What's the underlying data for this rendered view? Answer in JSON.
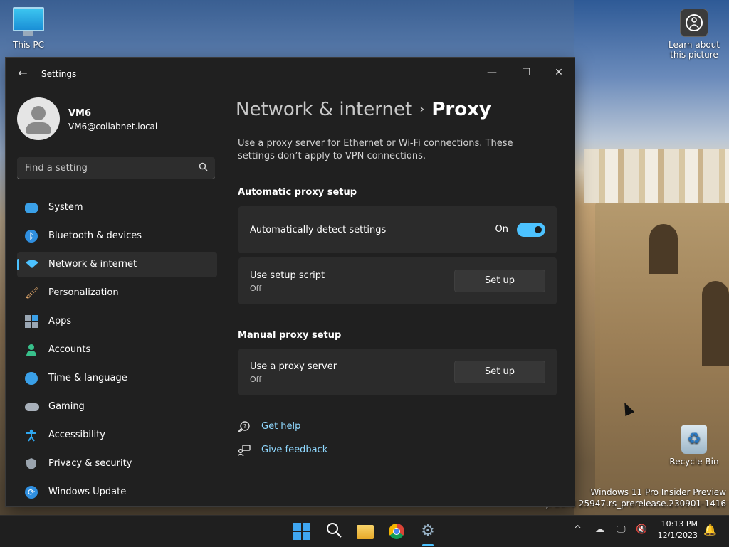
{
  "desktop": {
    "this_pc": "This PC",
    "learn_about_line1": "Learn about",
    "learn_about_line2": "this picture",
    "recycle_bin": "Recycle Bin",
    "watermark_line1": "Windows 11 Pro Insider Preview",
    "watermark_line2": "y. Build 25947.rs_prerelease.230901-1416"
  },
  "window": {
    "title": "Settings",
    "minimize": "—",
    "maximize": "☐",
    "close": "✕"
  },
  "profile": {
    "name": "VM6",
    "email": "VM6@collabnet.local"
  },
  "search": {
    "placeholder": "Find a setting"
  },
  "nav": {
    "items": [
      {
        "label": "System",
        "icon": "monitor-icon",
        "color": "#3aa0e8"
      },
      {
        "label": "Bluetooth & devices",
        "icon": "bluetooth-icon",
        "color": "#2f8fe0"
      },
      {
        "label": "Network & internet",
        "icon": "wifi-icon",
        "color": "#4cc2ff",
        "selected": true
      },
      {
        "label": "Personalization",
        "icon": "brush-icon",
        "color": "#e2a86b"
      },
      {
        "label": "Apps",
        "icon": "apps-icon",
        "color": "#9aa7b4"
      },
      {
        "label": "Accounts",
        "icon": "person-icon",
        "color": "#38c08b"
      },
      {
        "label": "Time & language",
        "icon": "globe-clock-icon",
        "color": "#3aa0e8"
      },
      {
        "label": "Gaming",
        "icon": "controller-icon",
        "color": "#a8b0ba"
      },
      {
        "label": "Accessibility",
        "icon": "accessibility-icon",
        "color": "#2fa7f0"
      },
      {
        "label": "Privacy & security",
        "icon": "shield-icon",
        "color": "#9aa4ae"
      },
      {
        "label": "Windows Update",
        "icon": "update-icon",
        "color": "#2f8fe0"
      }
    ]
  },
  "page": {
    "breadcrumb_parent": "Network & internet",
    "breadcrumb_sep": "›",
    "title": "Proxy",
    "description": "Use a proxy server for Ethernet or Wi-Fi connections. These settings don’t apply to VPN connections.",
    "auto_section": "Automatic proxy setup",
    "manual_section": "Manual proxy setup",
    "auto_detect": {
      "title": "Automatically detect settings",
      "state": "On"
    },
    "setup_script": {
      "title": "Use setup script",
      "sub": "Off",
      "button": "Set up"
    },
    "proxy_server": {
      "title": "Use a proxy server",
      "sub": "Off",
      "button": "Set up"
    },
    "get_help": "Get help",
    "give_feedback": "Give feedback"
  },
  "taskbar": {
    "time": "10:13 PM",
    "date": "12/1/2023"
  }
}
